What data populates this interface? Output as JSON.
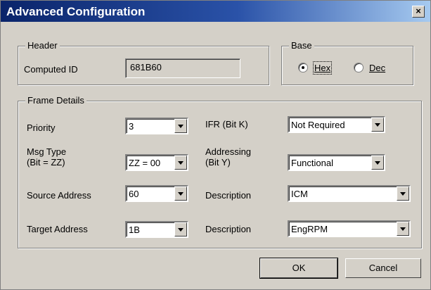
{
  "window": {
    "title": "Advanced Configuration",
    "close_glyph": "×"
  },
  "header": {
    "group_label": "Header",
    "computed_id_label": "Computed ID",
    "computed_id_value": "681B60"
  },
  "base": {
    "group_label": "Base",
    "hex_label": "Hex",
    "dec_label": "Dec",
    "selected": "Hex"
  },
  "frame": {
    "group_label": "Frame Details",
    "priority_label": "Priority",
    "priority_value": "3",
    "msgtype_label_1": "Msg Type",
    "msgtype_label_2": "(Bit = ZZ)",
    "msgtype_value": "ZZ = 00",
    "source_label": "Source Address",
    "source_value": "60",
    "target_label": "Target Address",
    "target_value": "1B",
    "ifr_label": "IFR (Bit K)",
    "ifr_value": "Not Required",
    "addressing_label_1": "Addressing",
    "addressing_label_2": "(Bit Y)",
    "addressing_value": "Functional",
    "desc1_label": "Description",
    "desc1_value": "ICM",
    "desc2_label": "Description",
    "desc2_value": "EngRPM"
  },
  "buttons": {
    "ok": "OK",
    "cancel": "Cancel"
  }
}
